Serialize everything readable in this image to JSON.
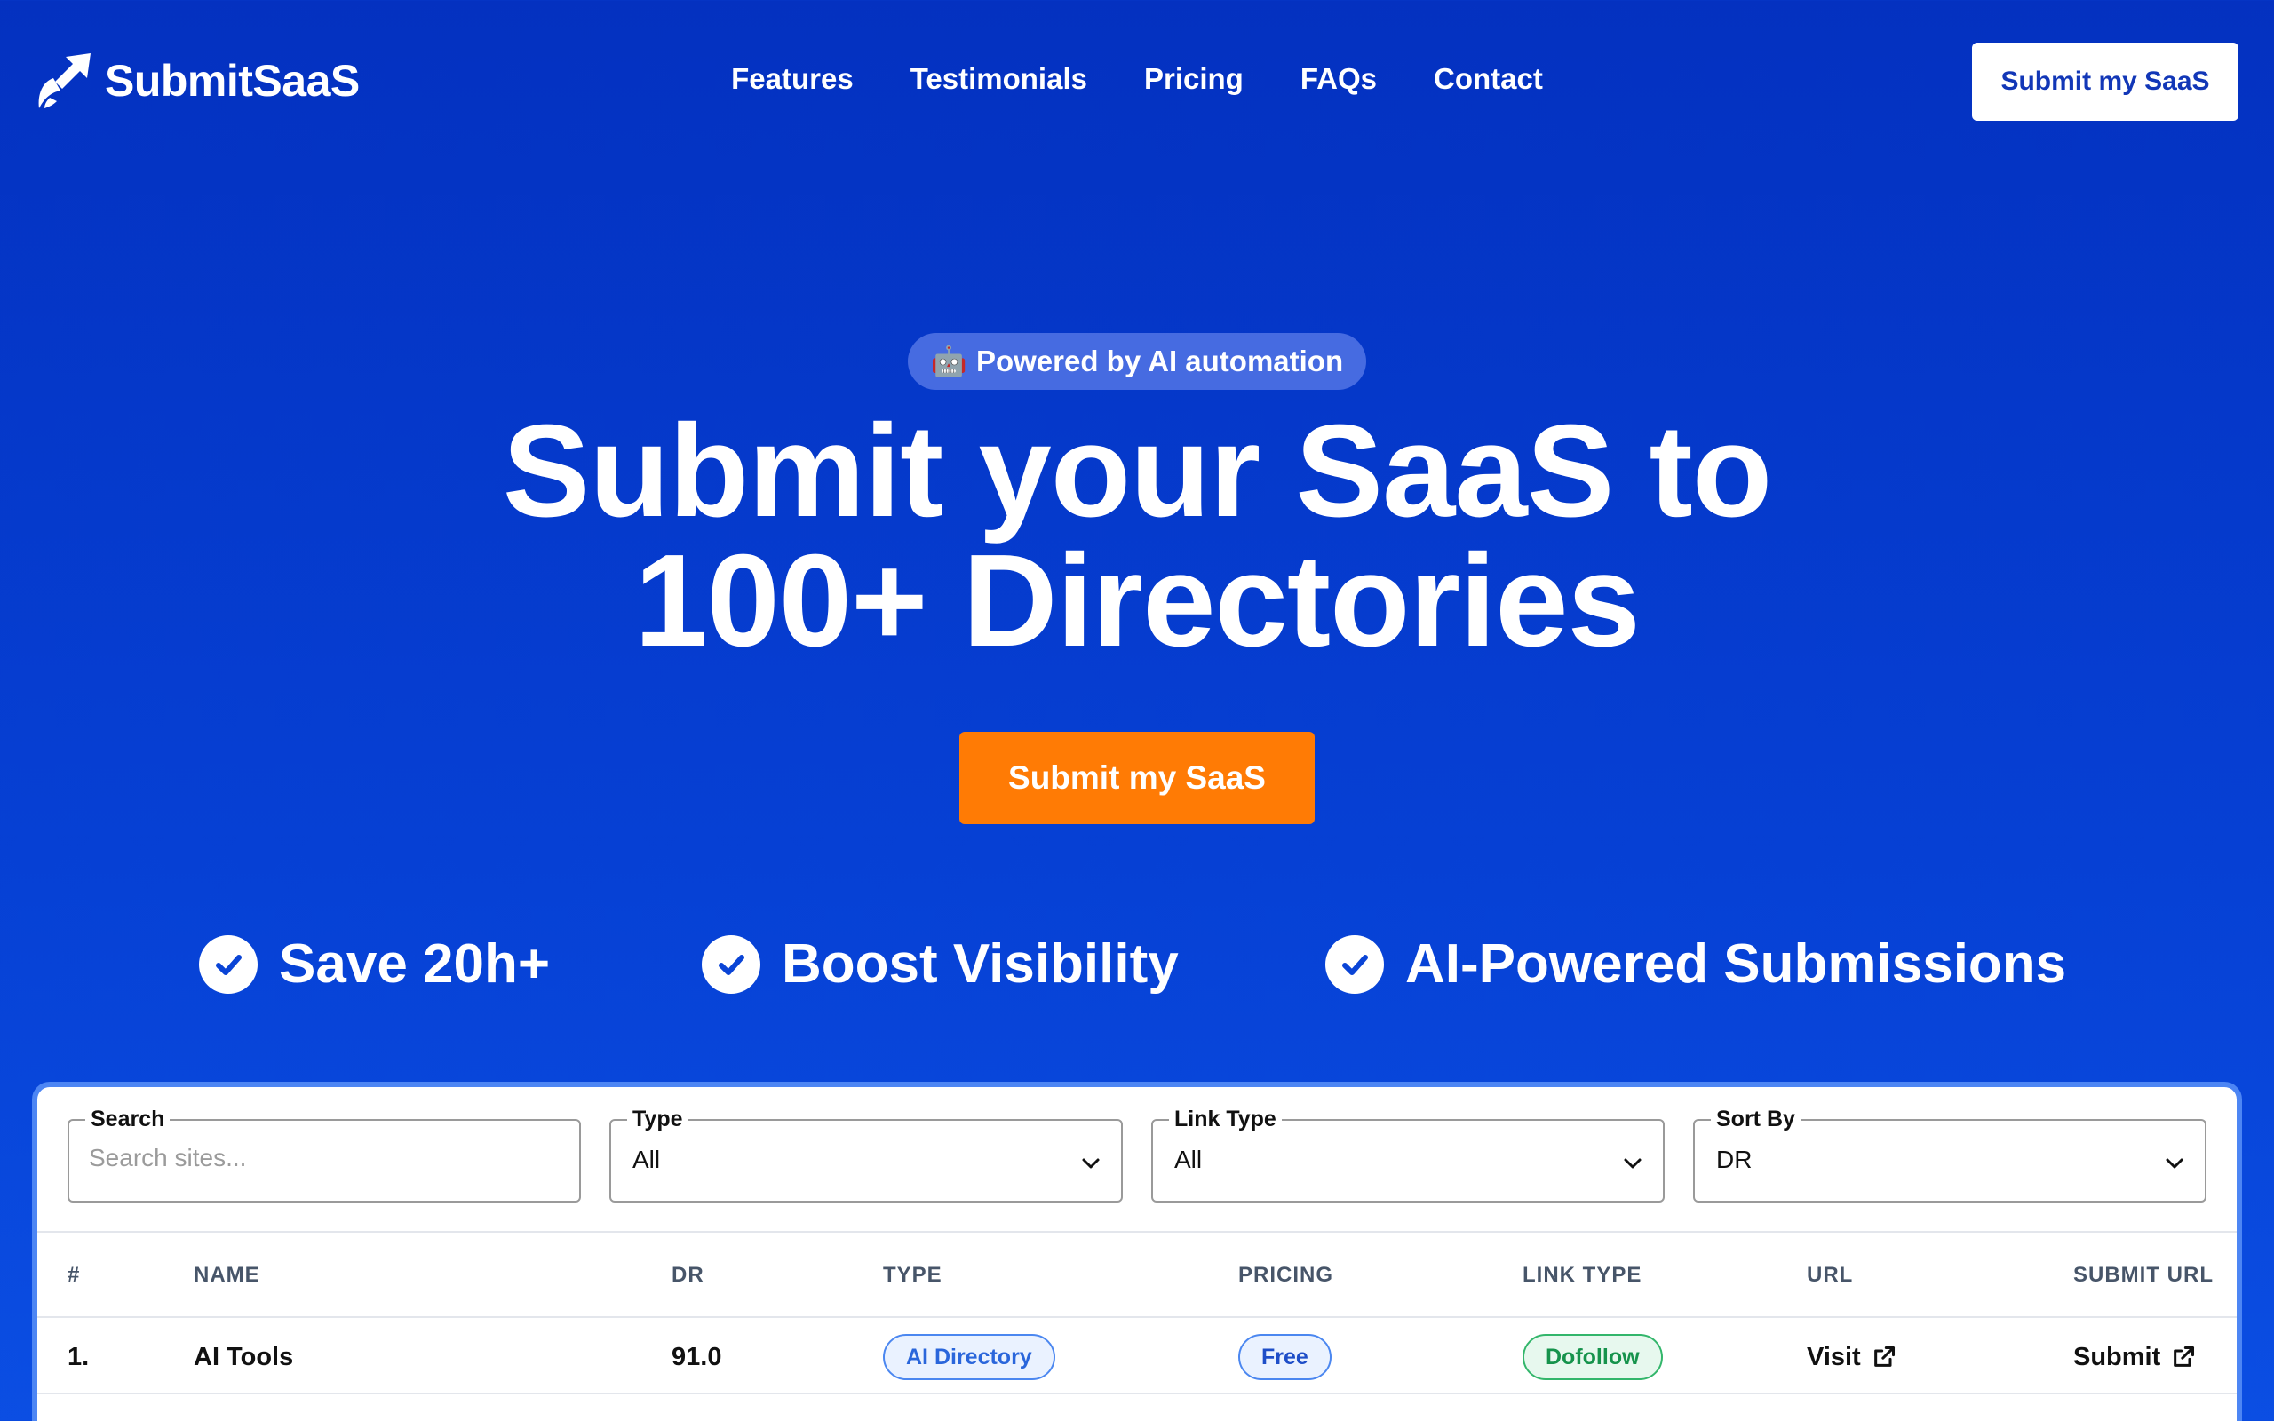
{
  "brand": {
    "name": "SubmitSaaS"
  },
  "nav": {
    "items": [
      "Features",
      "Testimonials",
      "Pricing",
      "FAQs",
      "Contact"
    ],
    "cta": "Submit my SaaS"
  },
  "hero": {
    "badge_emoji": "🤖",
    "badge_text": "Powered by AI automation",
    "title_line1": "Submit your SaaS to",
    "title_line2": "100+ Directories",
    "cta": "Submit my SaaS"
  },
  "features": [
    "Save 20h+",
    "Boost Visibility",
    "AI-Powered Submissions"
  ],
  "filters": {
    "search": {
      "label": "Search",
      "placeholder": "Search sites..."
    },
    "type": {
      "label": "Type",
      "value": "All"
    },
    "link_type": {
      "label": "Link Type",
      "value": "All"
    },
    "sort_by": {
      "label": "Sort By",
      "value": "DR"
    }
  },
  "table": {
    "columns": [
      "#",
      "NAME",
      "DR",
      "TYPE",
      "PRICING",
      "LINK TYPE",
      "URL",
      "SUBMIT URL"
    ],
    "rows": [
      {
        "index": "1.",
        "name": "AI Tools",
        "dr": "91.0",
        "type": "AI Directory",
        "pricing": "Free",
        "link_type": "Dofollow",
        "url_label": "Visit",
        "submit_label": "Submit"
      }
    ]
  },
  "colors": {
    "background": "#0437c4",
    "accent_orange": "#ff7b05",
    "header_cta_text": "#1237b7"
  }
}
